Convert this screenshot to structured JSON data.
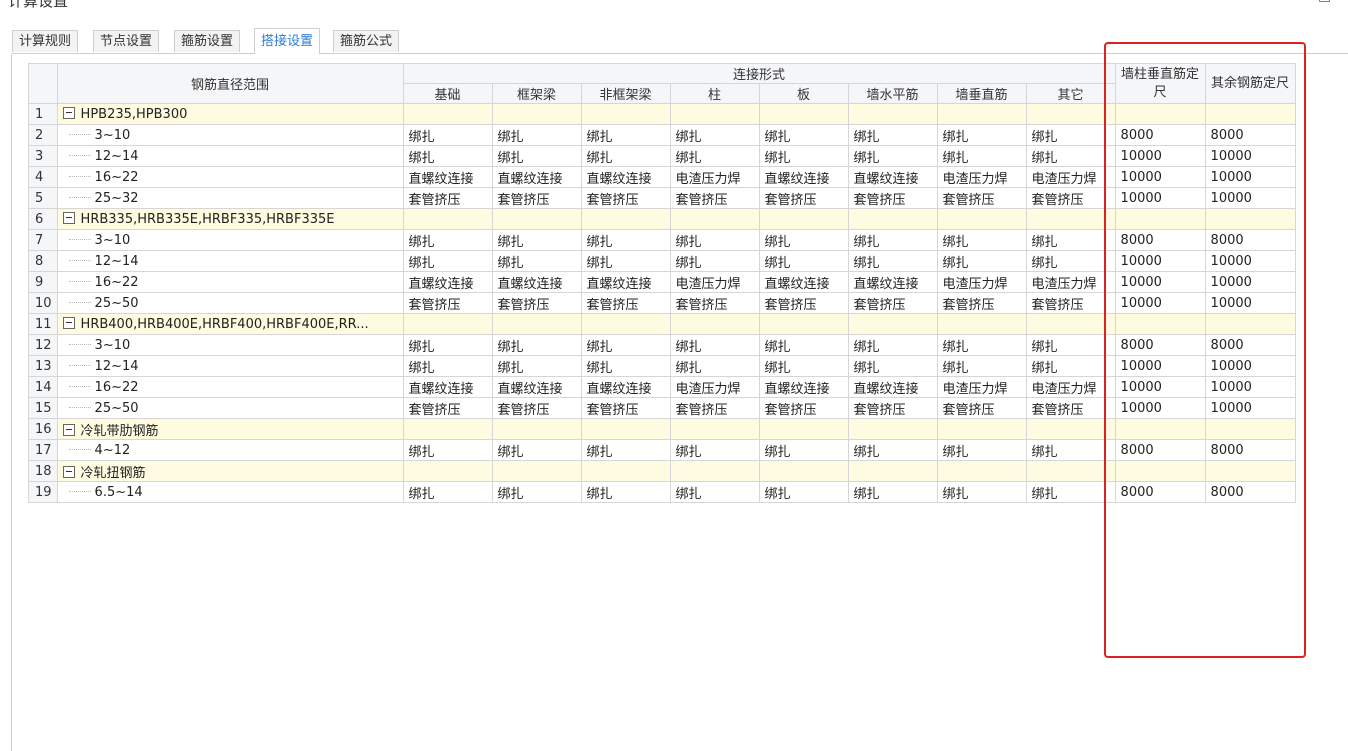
{
  "window": {
    "title": "计算设置"
  },
  "tabs": [
    {
      "label": "计算规则"
    },
    {
      "label": "节点设置"
    },
    {
      "label": "箍筋设置"
    },
    {
      "label": "搭接设置"
    },
    {
      "label": "箍筋公式"
    }
  ],
  "active_tab": 3,
  "table": {
    "header_range": "钢筋直径范围",
    "header_connection": "连接形式",
    "connection_columns": [
      "基础",
      "框架梁",
      "非框架梁",
      "柱",
      "板",
      "墙水平筋",
      "墙垂直筋",
      "其它"
    ],
    "header_wall_col_length": "墙柱垂直筋定尺",
    "header_other_length": "其余钢筋定尺",
    "rows": [
      {
        "num": "1",
        "group": true,
        "label": "HPB235,HPB300"
      },
      {
        "num": "2",
        "label": "3~10",
        "cells": [
          "绑扎",
          "绑扎",
          "绑扎",
          "绑扎",
          "绑扎",
          "绑扎",
          "绑扎",
          "绑扎",
          "8000",
          "8000"
        ]
      },
      {
        "num": "3",
        "label": "12~14",
        "cells": [
          "绑扎",
          "绑扎",
          "绑扎",
          "绑扎",
          "绑扎",
          "绑扎",
          "绑扎",
          "绑扎",
          "10000",
          "10000"
        ]
      },
      {
        "num": "4",
        "label": "16~22",
        "cells": [
          "直螺纹连接",
          "直螺纹连接",
          "直螺纹连接",
          "电渣压力焊",
          "直螺纹连接",
          "直螺纹连接",
          "电渣压力焊",
          "电渣压力焊",
          "10000",
          "10000"
        ]
      },
      {
        "num": "5",
        "label": "25~32",
        "cells": [
          "套管挤压",
          "套管挤压",
          "套管挤压",
          "套管挤压",
          "套管挤压",
          "套管挤压",
          "套管挤压",
          "套管挤压",
          "10000",
          "10000"
        ]
      },
      {
        "num": "6",
        "group": true,
        "label": "HRB335,HRB335E,HRBF335,HRBF335E"
      },
      {
        "num": "7",
        "label": "3~10",
        "cells": [
          "绑扎",
          "绑扎",
          "绑扎",
          "绑扎",
          "绑扎",
          "绑扎",
          "绑扎",
          "绑扎",
          "8000",
          "8000"
        ]
      },
      {
        "num": "8",
        "label": "12~14",
        "cells": [
          "绑扎",
          "绑扎",
          "绑扎",
          "绑扎",
          "绑扎",
          "绑扎",
          "绑扎",
          "绑扎",
          "10000",
          "10000"
        ]
      },
      {
        "num": "9",
        "label": "16~22",
        "cells": [
          "直螺纹连接",
          "直螺纹连接",
          "直螺纹连接",
          "电渣压力焊",
          "直螺纹连接",
          "直螺纹连接",
          "电渣压力焊",
          "电渣压力焊",
          "10000",
          "10000"
        ]
      },
      {
        "num": "10",
        "label": "25~50",
        "cells": [
          "套管挤压",
          "套管挤压",
          "套管挤压",
          "套管挤压",
          "套管挤压",
          "套管挤压",
          "套管挤压",
          "套管挤压",
          "10000",
          "10000"
        ]
      },
      {
        "num": "11",
        "group": true,
        "label": "HRB400,HRB400E,HRBF400,HRBF400E,RR..."
      },
      {
        "num": "12",
        "label": "3~10",
        "cells": [
          "绑扎",
          "绑扎",
          "绑扎",
          "绑扎",
          "绑扎",
          "绑扎",
          "绑扎",
          "绑扎",
          "8000",
          "8000"
        ]
      },
      {
        "num": "13",
        "label": "12~14",
        "cells": [
          "绑扎",
          "绑扎",
          "绑扎",
          "绑扎",
          "绑扎",
          "绑扎",
          "绑扎",
          "绑扎",
          "10000",
          "10000"
        ]
      },
      {
        "num": "14",
        "label": "16~22",
        "cells": [
          "直螺纹连接",
          "直螺纹连接",
          "直螺纹连接",
          "电渣压力焊",
          "直螺纹连接",
          "直螺纹连接",
          "电渣压力焊",
          "电渣压力焊",
          "10000",
          "10000"
        ]
      },
      {
        "num": "15",
        "label": "25~50",
        "cells": [
          "套管挤压",
          "套管挤压",
          "套管挤压",
          "套管挤压",
          "套管挤压",
          "套管挤压",
          "套管挤压",
          "套管挤压",
          "10000",
          "10000"
        ]
      },
      {
        "num": "16",
        "group": true,
        "label": "冷轧带肋钢筋"
      },
      {
        "num": "17",
        "label": "4~12",
        "cells": [
          "绑扎",
          "绑扎",
          "绑扎",
          "绑扎",
          "绑扎",
          "绑扎",
          "绑扎",
          "绑扎",
          "8000",
          "8000"
        ]
      },
      {
        "num": "18",
        "group": true,
        "label": "冷轧扭钢筋"
      },
      {
        "num": "19",
        "label": "6.5~14",
        "cells": [
          "绑扎",
          "绑扎",
          "绑扎",
          "绑扎",
          "绑扎",
          "绑扎",
          "绑扎",
          "绑扎",
          "8000",
          "8000"
        ]
      }
    ]
  },
  "colors": {
    "highlight_box": "#e02020",
    "group_row_bg": "#fefbe0",
    "active_tab_text": "#2d7dd2"
  }
}
